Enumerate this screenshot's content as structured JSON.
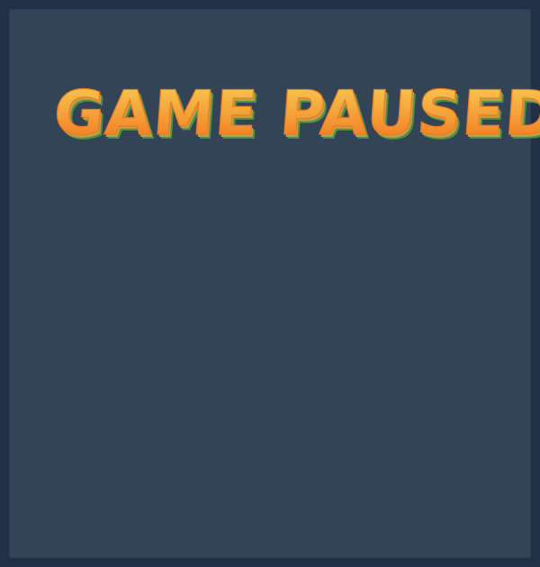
{
  "pause_screen": {
    "title": "GAME PAUSED"
  },
  "colors": {
    "outer_background": "#223047",
    "panel_background": "#344457",
    "title_top": "#f6c94a",
    "title_bottom": "#f07a22",
    "title_shadow": "#4f8f48"
  }
}
